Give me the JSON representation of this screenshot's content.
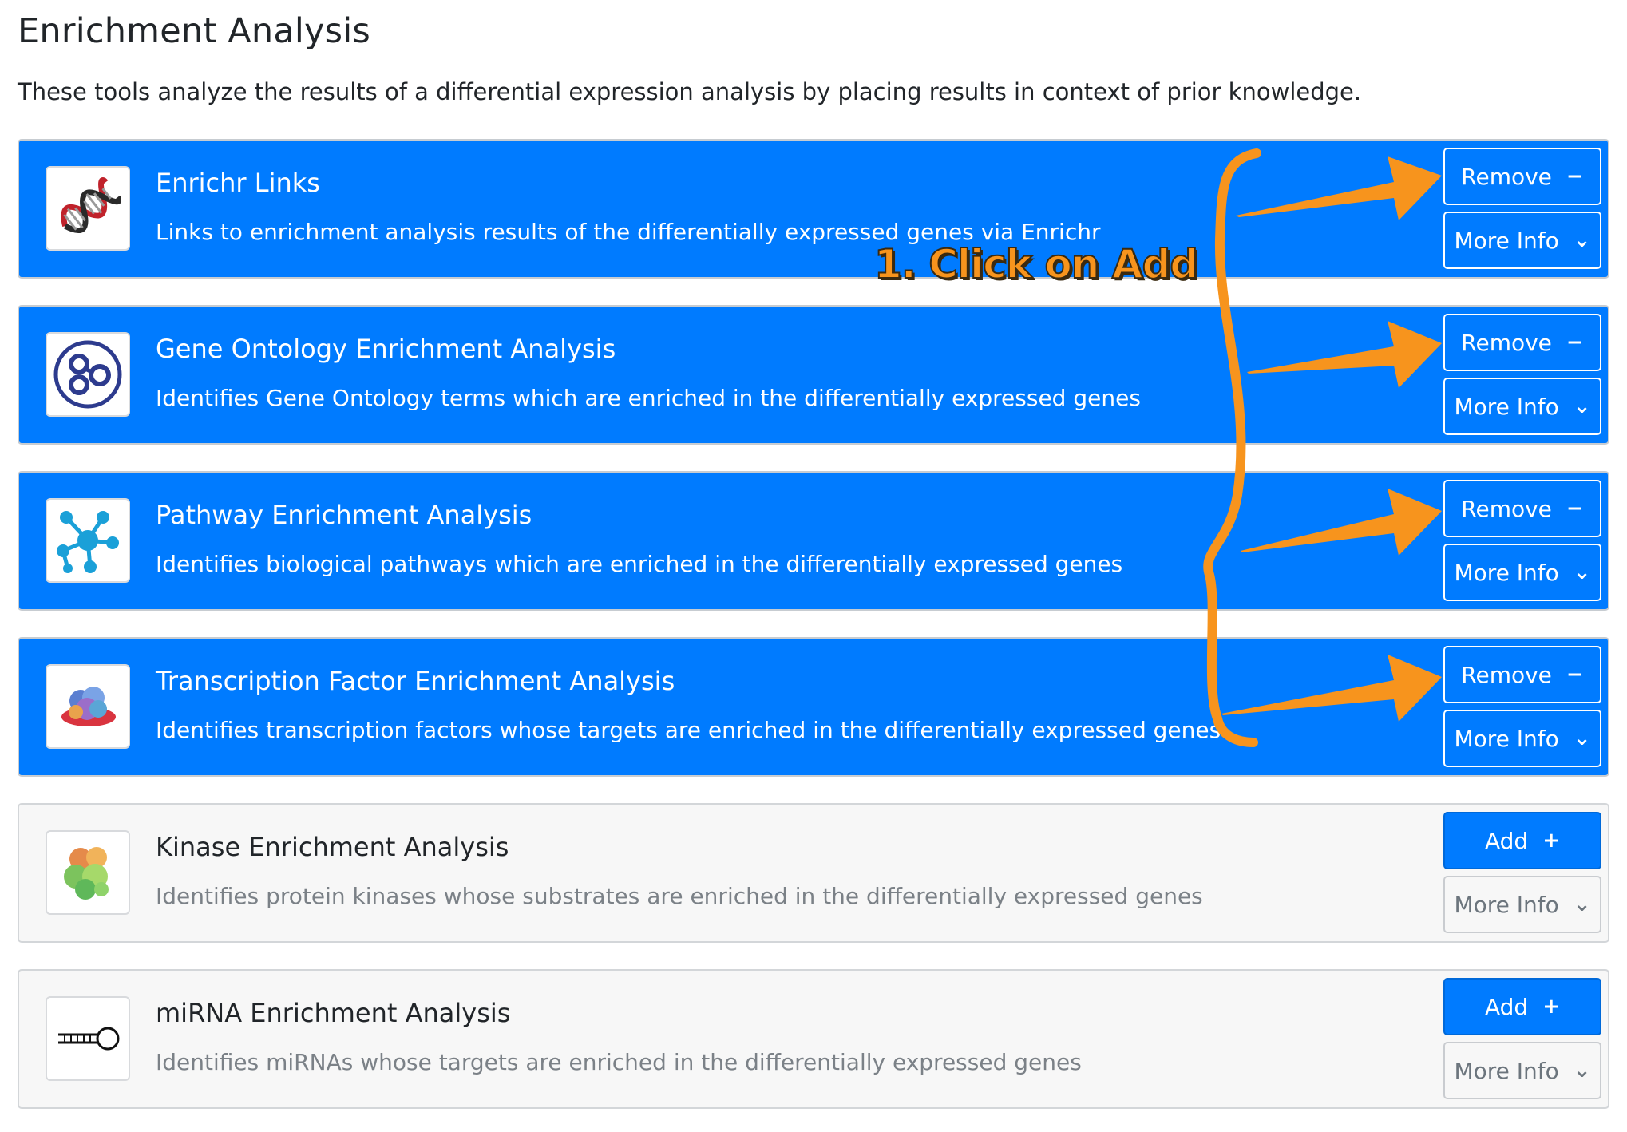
{
  "page": {
    "title": "Enrichment Analysis",
    "description": "These tools analyze the results of a differential expression analysis by placing results in context of prior knowledge."
  },
  "cards": [
    {
      "title": "Enrichr Links",
      "subtitle": "Links to enrichment analysis results of the differentially expressed genes via Enrichr",
      "selected": true,
      "primary_label": "Remove",
      "primary_glyph": "−",
      "info_label": "More Info",
      "info_glyph": "⌄",
      "icon": "dna-icon"
    },
    {
      "title": "Gene Ontology Enrichment Analysis",
      "subtitle": "Identifies Gene Ontology terms which are enriched in the differentially expressed genes",
      "selected": true,
      "primary_label": "Remove",
      "primary_glyph": "−",
      "info_label": "More Info",
      "info_glyph": "⌄",
      "icon": "gene-ontology-icon"
    },
    {
      "title": "Pathway Enrichment Analysis",
      "subtitle": "Identifies biological pathways which are enriched in the differentially expressed genes",
      "selected": true,
      "primary_label": "Remove",
      "primary_glyph": "−",
      "info_label": "More Info",
      "info_glyph": "⌄",
      "icon": "pathway-network-icon"
    },
    {
      "title": "Transcription Factor Enrichment Analysis",
      "subtitle": "Identifies transcription factors whose targets are enriched in the differentially expressed genes",
      "selected": true,
      "primary_label": "Remove",
      "primary_glyph": "−",
      "info_label": "More Info",
      "info_glyph": "⌄",
      "icon": "transcription-factor-protein-icon"
    },
    {
      "title": "Kinase Enrichment Analysis",
      "subtitle": "Identifies protein kinases whose substrates are enriched in the differentially expressed genes",
      "selected": false,
      "primary_label": "Add",
      "primary_glyph": "+",
      "info_label": "More Info",
      "info_glyph": "⌄",
      "icon": "kinase-protein-icon"
    },
    {
      "title": "miRNA Enrichment Analysis",
      "subtitle": "Identifies miRNAs whose targets are enriched in the differentially expressed genes",
      "selected": false,
      "primary_label": "Add",
      "primary_glyph": "+",
      "info_label": "More Info",
      "info_glyph": "⌄",
      "icon": "mirna-hairpin-icon"
    }
  ],
  "annotation": {
    "text": "1. Click on Add",
    "color": "#f7941d"
  },
  "colors": {
    "selected_card": "#007bff",
    "unselected_card": "#f7f7f7",
    "add_button": "#007bff"
  }
}
